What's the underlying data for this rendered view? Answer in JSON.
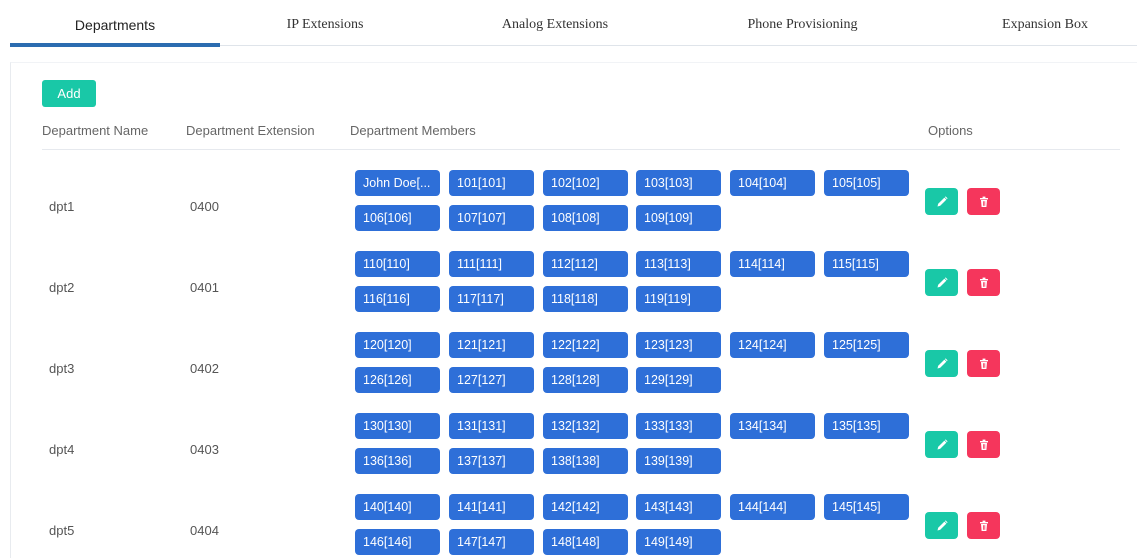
{
  "tabs": [
    {
      "label": "Departments",
      "active": true
    },
    {
      "label": "IP Extensions",
      "active": false
    },
    {
      "label": "Analog Extensions",
      "active": false
    },
    {
      "label": "Phone Provisioning",
      "active": false
    },
    {
      "label": "Expansion Box",
      "active": false
    }
  ],
  "toolbar": {
    "add_label": "Add"
  },
  "table": {
    "headers": {
      "name": "Department Name",
      "extension": "Department Extension",
      "members": "Department Members",
      "options": "Options"
    },
    "rows": [
      {
        "name": "dpt1",
        "extension": "0400",
        "members": [
          "John Doe[...",
          "101[101]",
          "102[102]",
          "103[103]",
          "104[104]",
          "105[105]",
          "106[106]",
          "107[107]",
          "108[108]",
          "109[109]"
        ]
      },
      {
        "name": "dpt2",
        "extension": "0401",
        "members": [
          "110[110]",
          "111[111]",
          "112[112]",
          "113[113]",
          "114[114]",
          "115[115]",
          "116[116]",
          "117[117]",
          "118[118]",
          "119[119]"
        ]
      },
      {
        "name": "dpt3",
        "extension": "0402",
        "members": [
          "120[120]",
          "121[121]",
          "122[122]",
          "123[123]",
          "124[124]",
          "125[125]",
          "126[126]",
          "127[127]",
          "128[128]",
          "129[129]"
        ]
      },
      {
        "name": "dpt4",
        "extension": "0403",
        "members": [
          "130[130]",
          "131[131]",
          "132[132]",
          "133[133]",
          "134[134]",
          "135[135]",
          "136[136]",
          "137[137]",
          "138[138]",
          "139[139]"
        ]
      },
      {
        "name": "dpt5",
        "extension": "0404",
        "members": [
          "140[140]",
          "141[141]",
          "142[142]",
          "143[143]",
          "144[144]",
          "145[145]",
          "146[146]",
          "147[147]",
          "148[148]",
          "149[149]"
        ]
      }
    ]
  },
  "icons": {
    "edit": "pencil-icon",
    "delete": "trash-icon"
  },
  "colors": {
    "accent_tab": "#2b6cb0",
    "add_button": "#19c8a7",
    "chip": "#2e6fd8",
    "edit_button": "#19c8a7",
    "delete_button": "#f5365c"
  }
}
